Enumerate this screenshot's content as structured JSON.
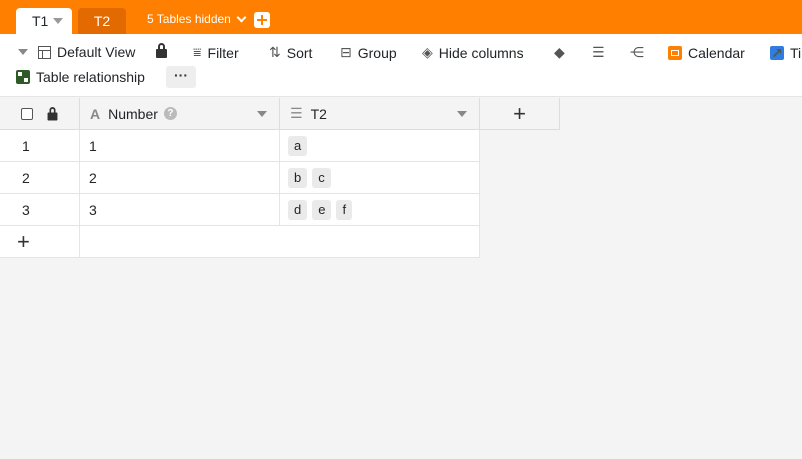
{
  "tabs": [
    {
      "label": "T1",
      "active": true
    },
    {
      "label": "T2",
      "active": false
    }
  ],
  "hidden_tables_label": "5 Tables hidden",
  "toolbar": {
    "view_label": "Default View",
    "filter_label": "Filter",
    "sort_label": "Sort",
    "group_label": "Group",
    "hide_columns_label": "Hide columns",
    "calendar_label": "Calendar",
    "truncated_label": "Ti",
    "table_relationship_label": "Table relationship",
    "more_label": "···"
  },
  "columns": [
    {
      "name": "Number",
      "type_icon": "text-type-icon"
    },
    {
      "name": "T2",
      "type_icon": "link-type-icon"
    }
  ],
  "rows": [
    {
      "index": "1",
      "number": "1",
      "links": [
        "a"
      ]
    },
    {
      "index": "2",
      "number": "2",
      "links": [
        "b",
        "c"
      ]
    },
    {
      "index": "3",
      "number": "3",
      "links": [
        "d",
        "e",
        "f"
      ]
    }
  ],
  "colors": {
    "brand_orange": "#ff8000",
    "inactive_tab": "#e36a00",
    "calendar_icon": "#ff8000",
    "plugin_icon": "#2f7de1",
    "relationship_icon": "#2d5a27"
  }
}
